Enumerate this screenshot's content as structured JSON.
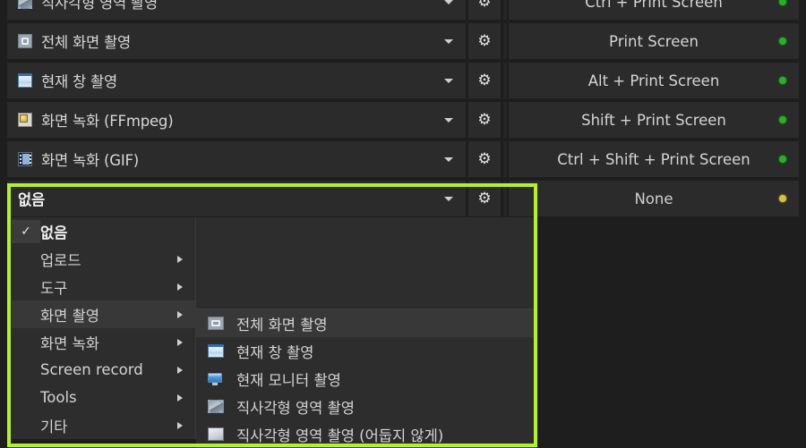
{
  "theme": {
    "page_bg": "#1e1e1e",
    "cell_bg": "#2b2b2b",
    "menu_bg": "#2d2d2d",
    "menu_hover_bg": "#383838",
    "highlight_color": "#b6f126",
    "text_color": "#d5d5d5",
    "dot_enabled": "#22b422",
    "dot_none": "#d8c03a"
  },
  "hotkey_table": {
    "rows": [
      {
        "icon": "rectangle-region-capture-icon",
        "icon_class": "ic-region",
        "task": "직사각형 영역 촬영",
        "hotkey": "Ctrl + Print Screen",
        "status": "enabled",
        "dot_color": "#22b422",
        "caret": "chevron-down-icon",
        "gear": "gear-icon"
      },
      {
        "icon": "fullscreen-capture-icon",
        "icon_class": "ic-fullscreen",
        "task": "전체 화면 촬영",
        "hotkey": "Print Screen",
        "status": "enabled",
        "dot_color": "#22b422",
        "caret": "chevron-down-icon",
        "gear": "gear-icon"
      },
      {
        "icon": "active-window-capture-icon",
        "icon_class": "ic-window",
        "task": "현재 창 촬영",
        "hotkey": "Alt + Print Screen",
        "status": "enabled",
        "dot_color": "#22b422",
        "caret": "chevron-down-icon",
        "gear": "gear-icon"
      },
      {
        "icon": "screen-record-ffmpeg-icon",
        "icon_class": "ic-ffmpeg",
        "task": "화면 녹화 (FFmpeg)",
        "hotkey": "Shift + Print Screen",
        "status": "enabled",
        "dot_color": "#22b422",
        "caret": "chevron-down-icon",
        "gear": "gear-icon"
      },
      {
        "icon": "screen-record-gif-icon",
        "icon_class": "ic-gif",
        "task": "화면 녹화 (GIF)",
        "hotkey": "Ctrl + Shift + Print Screen",
        "status": "enabled",
        "dot_color": "#22b422",
        "caret": "chevron-down-icon",
        "gear": "gear-icon"
      },
      {
        "icon": "none-task-icon",
        "icon_class": "ic-none",
        "task": "없음",
        "hotkey": "None",
        "status": "unassigned",
        "dot_color": "#d8c03a",
        "caret": "chevron-down-icon",
        "gear": "gear-icon"
      }
    ]
  },
  "dropdown_menu": {
    "items": [
      {
        "label": "없음",
        "checked": true,
        "has_submenu": false,
        "bold": true,
        "highlighted": false
      },
      {
        "label": "업로드",
        "checked": false,
        "has_submenu": true,
        "bold": false,
        "highlighted": false
      },
      {
        "label": "도구",
        "checked": false,
        "has_submenu": true,
        "bold": false,
        "highlighted": false
      },
      {
        "label": "화면 촬영",
        "checked": false,
        "has_submenu": true,
        "bold": false,
        "highlighted": true
      },
      {
        "label": "화면 녹화",
        "checked": false,
        "has_submenu": true,
        "bold": false,
        "highlighted": false
      },
      {
        "label": "Screen record",
        "checked": false,
        "has_submenu": true,
        "bold": false,
        "highlighted": false
      },
      {
        "label": "Tools",
        "checked": false,
        "has_submenu": true,
        "bold": false,
        "highlighted": false
      },
      {
        "label": "기타",
        "checked": false,
        "has_submenu": true,
        "bold": false,
        "highlighted": false
      }
    ],
    "check_glyph": "✓"
  },
  "submenu": {
    "parent": "화면 촬영",
    "items": [
      {
        "label": "전체 화면 촬영",
        "icon": "fullscreen-capture-icon",
        "icon_class": "ic-fullscreen",
        "hovered": true
      },
      {
        "label": "현재 창 촬영",
        "icon": "active-window-capture-icon",
        "icon_class": "ic-window",
        "hovered": false
      },
      {
        "label": "현재 모니터 촬영",
        "icon": "active-monitor-capture-icon",
        "icon_class": "ic-monitor",
        "hovered": false
      },
      {
        "label": "직사각형 영역 촬영",
        "icon": "rectangle-region-capture-icon",
        "icon_class": "ic-region",
        "hovered": false
      },
      {
        "label": "직사각형 영역 촬영 (어둡지 않게)",
        "icon": "rectangle-light-capture-icon",
        "icon_class": "ic-plain",
        "hovered": false
      }
    ]
  }
}
